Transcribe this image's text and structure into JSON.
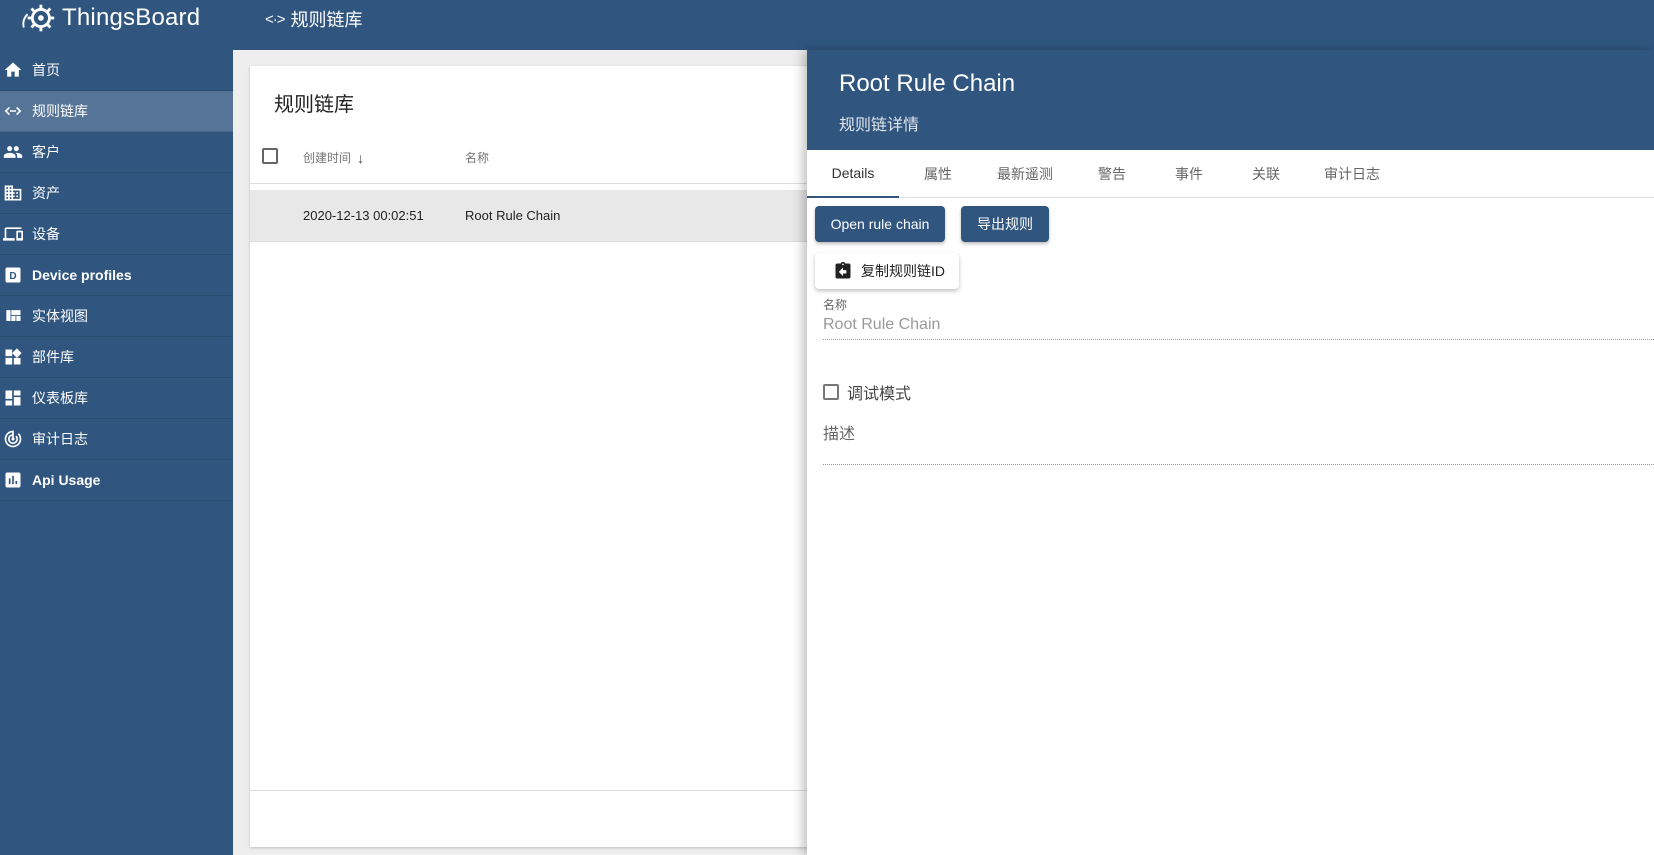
{
  "app": {
    "name": "ThingsBoard"
  },
  "topbar": {
    "icon": "code-icon",
    "title": "规则链库"
  },
  "sidebar": {
    "items": [
      {
        "icon": "home-icon",
        "label": "首页",
        "bold": false,
        "active": false
      },
      {
        "icon": "code-icon",
        "label": "规则链库",
        "bold": false,
        "active": true
      },
      {
        "icon": "people-icon",
        "label": "客户",
        "bold": false,
        "active": false
      },
      {
        "icon": "business-icon",
        "label": "资产",
        "bold": false,
        "active": false
      },
      {
        "icon": "devices-icon",
        "label": "设备",
        "bold": false,
        "active": false
      },
      {
        "icon": "device-profile-icon",
        "label": "Device profiles",
        "bold": true,
        "active": false
      },
      {
        "icon": "view-quilt-icon",
        "label": "实体视图",
        "bold": false,
        "active": false
      },
      {
        "icon": "widgets-icon",
        "label": "部件库",
        "bold": false,
        "active": false
      },
      {
        "icon": "dashboard-icon",
        "label": "仪表板库",
        "bold": false,
        "active": false
      },
      {
        "icon": "track-changes-icon",
        "label": "审计日志",
        "bold": false,
        "active": false
      },
      {
        "icon": "insert-chart-icon",
        "label": "Api Usage",
        "bold": true,
        "active": false
      }
    ]
  },
  "table": {
    "title": "规则链库",
    "columns": {
      "created": "创建时间",
      "name": "名称"
    },
    "rows": [
      {
        "created": "2020-12-13 00:02:51",
        "name": "Root Rule Chain"
      }
    ]
  },
  "details": {
    "title": "Root Rule Chain",
    "subtitle": "规则链详情",
    "tabs": [
      "Details",
      "属性",
      "最新遥测",
      "警告",
      "事件",
      "关联",
      "审计日志"
    ],
    "open_button": "Open rule chain",
    "export_button": "导出规则",
    "copy_button": "复制规则链ID",
    "name_label": "名称",
    "name_value": "Root Rule Chain",
    "debug_label": "调试模式",
    "description_label": "描述"
  },
  "colors": {
    "primary": "#305680",
    "selected_row": "#e8e8e8"
  }
}
